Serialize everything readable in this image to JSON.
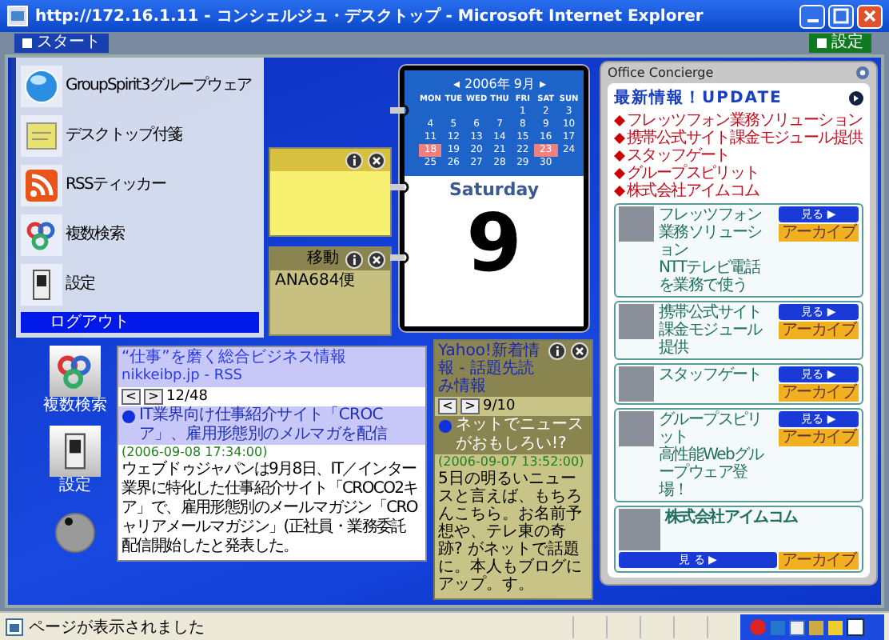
{
  "window": {
    "title": "http://172.16.1.11 - コンシェルジュ・デスクトップ - Microsoft Internet Explorer"
  },
  "toolbar": {
    "start_button": "スタート",
    "settings_button": "設定"
  },
  "start_menu": {
    "items": [
      {
        "label": "GroupSpirit3グループウェア",
        "kind": "groupware"
      },
      {
        "label": "デスクトップ付箋",
        "kind": "note"
      },
      {
        "label": "RSSティッカー",
        "kind": "rss"
      },
      {
        "label": "複数検索",
        "kind": "search"
      },
      {
        "label": "設定",
        "kind": "settings"
      }
    ],
    "logout": "ログアウト"
  },
  "desktop_icons": [
    {
      "label": "複数検索",
      "kind": "search"
    },
    {
      "label": "設定",
      "kind": "settings"
    }
  ],
  "sticky_notes": [
    {
      "kind": "yellow"
    },
    {
      "kind": "olive",
      "header_text": "移動",
      "text": "ANA684便"
    }
  ],
  "calendar": {
    "prev": "◂",
    "month_label": "2006年 9月",
    "next": "▸",
    "weekdays": [
      "MON",
      "TUE",
      "WED",
      "THU",
      "FRI",
      "SAT",
      "SUN"
    ],
    "weeks": [
      [
        {
          "day": "1",
          "marked": false
        },
        {
          "day": "2",
          "marked": false
        },
        {
          "day": "3",
          "marked": false
        }
      ],
      [
        {
          "day": "4",
          "marked": false
        },
        {
          "day": "5",
          "marked": false
        },
        {
          "day": "6",
          "marked": false
        },
        {
          "day": "7",
          "marked": false
        },
        {
          "day": "8",
          "marked": false
        },
        {
          "day": "9",
          "marked": false
        },
        {
          "day": "10",
          "marked": false
        }
      ],
      [
        {
          "day": "11",
          "marked": false
        },
        {
          "day": "12",
          "marked": false
        },
        {
          "day": "13",
          "marked": false
        },
        {
          "day": "14",
          "marked": false
        },
        {
          "day": "15",
          "marked": false
        },
        {
          "day": "16",
          "marked": false
        },
        {
          "day": "17",
          "marked": false
        }
      ],
      [
        {
          "day": "18",
          "marked": true
        },
        {
          "day": "19",
          "marked": false
        },
        {
          "day": "20",
          "marked": false
        },
        {
          "day": "21",
          "marked": false
        },
        {
          "day": "22",
          "marked": false
        },
        {
          "day": "23",
          "marked": true
        },
        {
          "day": "24",
          "marked": false
        }
      ],
      [
        {
          "day": "25",
          "marked": false
        },
        {
          "day": "26",
          "marked": false
        },
        {
          "day": "27",
          "marked": false
        },
        {
          "day": "28",
          "marked": false
        },
        {
          "day": "29",
          "marked": false
        },
        {
          "day": "30",
          "marked": false
        }
      ]
    ],
    "weekday_name": "Saturday",
    "day": "9"
  },
  "rss_widget": {
    "title": "“仕事”を磨く総合ビジネス情報",
    "source": "nikkeibp.jp - RSS",
    "prev": "<",
    "next": ">",
    "position": "12/48",
    "headline_lines": [
      "IT業界向け仕事紹介サイト「CROC",
      "ア」、雇用形態別のメルマガを配信"
    ],
    "date": "(2006-09-08 17:34:00)",
    "body_lines": [
      "ウェブドゥジャパンは9月8日、IT／インター",
      "業界に特化した仕事紹介サイト「CROCO2キ",
      "ア」で、雇用形態別のメールマガジン「CRO",
      "ャリアメールマガジン」(正社員・業務委託",
      "配信開始したと発表した。"
    ]
  },
  "yahoo_widget": {
    "title": "Yahoo!新着情報 - 話題先読み情報",
    "prev": "<",
    "next": ">",
    "position": "9/10",
    "headline": "ネットでニュースがおもしろい!?",
    "date": "(2006-09-07 13:52:00)",
    "body": "5日の明るいニュースと言えば、もちろんこちら。お名前予想や、テレ東の奇跡? がネットで話題に。本人もブログにアップ。す。"
  },
  "concierge": {
    "title": "Office Concierge",
    "heading": "最新情報！UPDATE",
    "links": [
      "フレッツフォン業務ソリューション",
      "携帯公式サイト課金モジュール提供",
      "スタッフゲート",
      "グループスピリット",
      "株式会社アイムコム"
    ],
    "cards": [
      {
        "kind": "compact",
        "title": "フレッツフォン業務ソリューション",
        "subtitle": "NTTテレビ電話を業務で使う",
        "view_button": "見る ▶",
        "archive_button": "アーカイブ"
      },
      {
        "kind": "compact",
        "title": "携帯公式サイト課金モジュール提供",
        "view_button": "見る ▶",
        "archive_button": "アーカイブ"
      },
      {
        "kind": "compact",
        "title": "スタッフゲート",
        "view_button": "見る ▶",
        "archive_button": "アーカイブ"
      },
      {
        "kind": "compact",
        "title": "グループスピリット",
        "subtitle": "高性能Webグループウェア登場！",
        "view_button": "見る ▶",
        "archive_button": "アーカイブ"
      },
      {
        "kind": "wide",
        "title": "株式会社アイムコム",
        "view_button": "見 る ▶",
        "archive_button": "アーカイブ"
      }
    ]
  },
  "status_bar": {
    "text": "ページが表示されました"
  }
}
